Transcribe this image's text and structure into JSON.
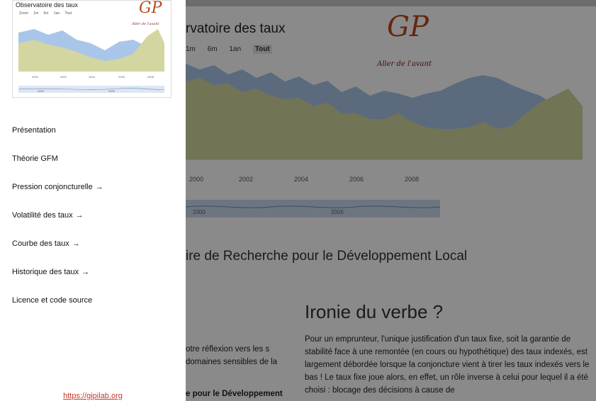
{
  "hero": {
    "title": "rvatoire des taux",
    "zoom_buttons": [
      "1m",
      "6m",
      "1an",
      "Tout"
    ],
    "logo_text": "GP",
    "logo_sub": "Aller de l'avant",
    "x_ticks": [
      "2000",
      "2002",
      "2004",
      "2006",
      "2008"
    ],
    "nav_ticks": [
      "2000",
      "2005"
    ]
  },
  "main": {
    "subtitle": "ire de Recherche pour le Développement Local",
    "section_heading": "Ironie du verbe ?",
    "paragraph": "Pour un emprunteur, l'unique justification d'un taux fixe, soit la garantie de stabilité face à une remontée (en cours ou hypothétique) des taux indexés, est largement débordée lorsque la conjoncture vient à tirer les taux indexés vers le bas ! Le taux fixe joue alors, en effet, un rôle inverse à celui pour lequel il a été choisi : blocage des décisions à cause de",
    "left_fragment": "otre réflexion vers les s domaines sensibles de la",
    "left_fragment_bold": "e pour le Développement"
  },
  "sidebar": {
    "thumbnail": {
      "title": "Observatoire des taux",
      "zoom_label": "Zoom",
      "zoom_buttons": [
        "1m",
        "6m",
        "1an",
        "Tout"
      ],
      "logo_text": "GP",
      "logo_sub": "Aller de l'avant",
      "x_ticks": [
        "2000",
        "2002",
        "2004",
        "2006",
        "2008"
      ],
      "nav_ticks": [
        "2000",
        "2005"
      ]
    },
    "items": [
      {
        "label": "Présentation",
        "arrow": ""
      },
      {
        "label": "Théorie GFM",
        "arrow": ""
      },
      {
        "label": "Pression conjoncturelle",
        "arrow": "→"
      },
      {
        "label": "Volatilité des taux",
        "arrow": "→"
      },
      {
        "label": "Courbe des taux",
        "arrow": "→"
      },
      {
        "label": "Historique des taux",
        "arrow": "→"
      },
      {
        "label": "Licence et code source",
        "arrow": ""
      }
    ],
    "footer_link": "https://gipilab.org"
  },
  "colors": {
    "accent_link": "#c0392b",
    "chart_blue": "#a9c6e8",
    "chart_olive": "#d3d6a0",
    "logo_red": "#b94a1a",
    "overlay": "rgba(0,0,0,0.46)"
  }
}
